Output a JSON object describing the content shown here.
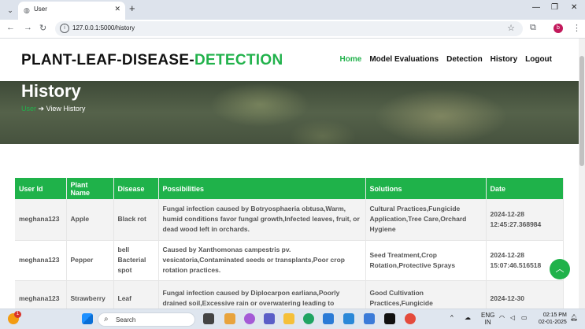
{
  "browser": {
    "tab_title": "User",
    "url": "127.0.0.1:5000/history",
    "profile_initial": "b"
  },
  "site": {
    "brand_main": "PLANT-LEAF-DISEASE-",
    "brand_accent": "DETECTION",
    "nav": [
      {
        "label": "Home",
        "active": true
      },
      {
        "label": "Model Evaluations"
      },
      {
        "label": "Detection"
      },
      {
        "label": "History"
      },
      {
        "label": "Logout"
      }
    ],
    "hero_title": "History",
    "breadcrumb_home": "User",
    "breadcrumb_current": "View History"
  },
  "table": {
    "headers": [
      "User Id",
      "Plant Name",
      "Disease",
      "Possibilities",
      "Solutions",
      "Date"
    ],
    "rows": [
      [
        "meghana123",
        "Apple",
        "Black rot",
        "Fungal infection caused by Botryosphaeria obtusa,Warm, humid conditions favor fungal growth,Infected leaves, fruit, or dead wood left in orchards.",
        "Cultural Practices,Fungicide Application,Tree Care,Orchard Hygiene",
        "2024-12-28 12:45:27.368984"
      ],
      [
        "meghana123",
        "Pepper",
        "bell Bacterial spot",
        "Caused by Xanthomonas campestris pv. vesicatoria,Contaminated seeds or transplants,Poor crop rotation practices.",
        "Seed Treatment,Crop Rotation,Protective Sprays",
        "2024-12-28 15:07:46.516518"
      ],
      [
        "meghana123",
        "Strawberry",
        "Leaf",
        "Fungal infection caused by Diplocarpon earliana,Poorly drained soil,Excessive rain or overwatering leading to",
        "Good Cultivation Practices,Fungicide",
        "2024-12-30"
      ]
    ]
  },
  "taskbar": {
    "search_label": "Search",
    "lang_line1": "ENG",
    "lang_line2": "IN",
    "time": "02:15 PM",
    "date": "02-01-2025",
    "notification_count": "1"
  },
  "colors": {
    "accent_green": "#22b24c",
    "table_header": "#1fb24a"
  }
}
